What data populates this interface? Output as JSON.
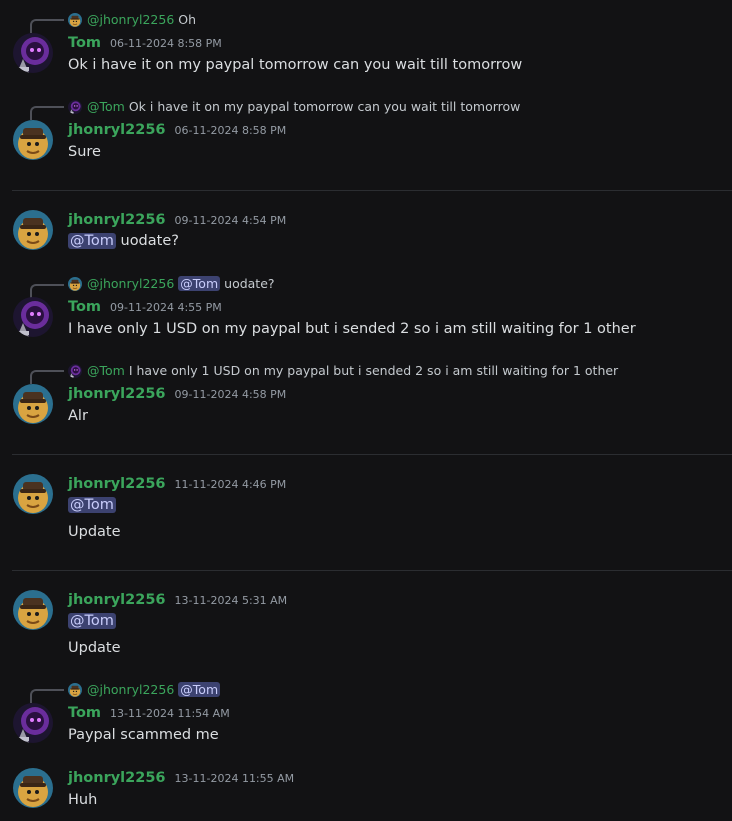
{
  "colors": {
    "background": "#121214",
    "username": "#3ba55c",
    "timestamp": "#949ba4",
    "message_text": "#dbdee1",
    "mention_bg": "#3c4270",
    "mention_text": "#c9cdfb",
    "divider": "#2b2d31"
  },
  "messages": [
    {
      "reply": {
        "name": "@jhonryl2256",
        "text": "Oh"
      },
      "author": "Tom",
      "timestamp": "06-11-2024 8:58 PM",
      "text": "Ok i have it on my paypal tomorrow can you wait till tomorrow"
    },
    {
      "reply": {
        "name": "@Tom",
        "text": "Ok i have it on my paypal tomorrow can you wait till tomorrow"
      },
      "author": "jhonryl2256",
      "timestamp": "06-11-2024 8:58 PM",
      "text": "Sure"
    },
    {
      "author": "jhonryl2256",
      "timestamp": "09-11-2024 4:54 PM",
      "mention": "@Tom",
      "text": "uodate?"
    },
    {
      "reply": {
        "name": "@jhonryl2256",
        "mention": "@Tom",
        "text": "uodate?"
      },
      "author": "Tom",
      "timestamp": "09-11-2024 4:55 PM",
      "text": "I have only 1 USD on my paypal but i sended 2 so i am still waiting for 1 other"
    },
    {
      "reply": {
        "name": "@Tom",
        "text": "I have only 1 USD on my paypal but i sended 2 so i am still waiting for 1 other"
      },
      "author": "jhonryl2256",
      "timestamp": "09-11-2024 4:58 PM",
      "text": "Alr"
    },
    {
      "author": "jhonryl2256",
      "timestamp": "11-11-2024 4:46 PM",
      "mention": "@Tom",
      "text": "Update"
    },
    {
      "author": "jhonryl2256",
      "timestamp": "13-11-2024 5:31 AM",
      "mention": "@Tom",
      "text": "Update"
    },
    {
      "reply": {
        "name": "@jhonryl2256",
        "mention": "@Tom"
      },
      "author": "Tom",
      "timestamp": "13-11-2024 11:54 AM",
      "text": "Paypal scammed me"
    },
    {
      "author": "jhonryl2256",
      "timestamp": "13-11-2024 11:55 AM",
      "text": "Huh"
    }
  ]
}
